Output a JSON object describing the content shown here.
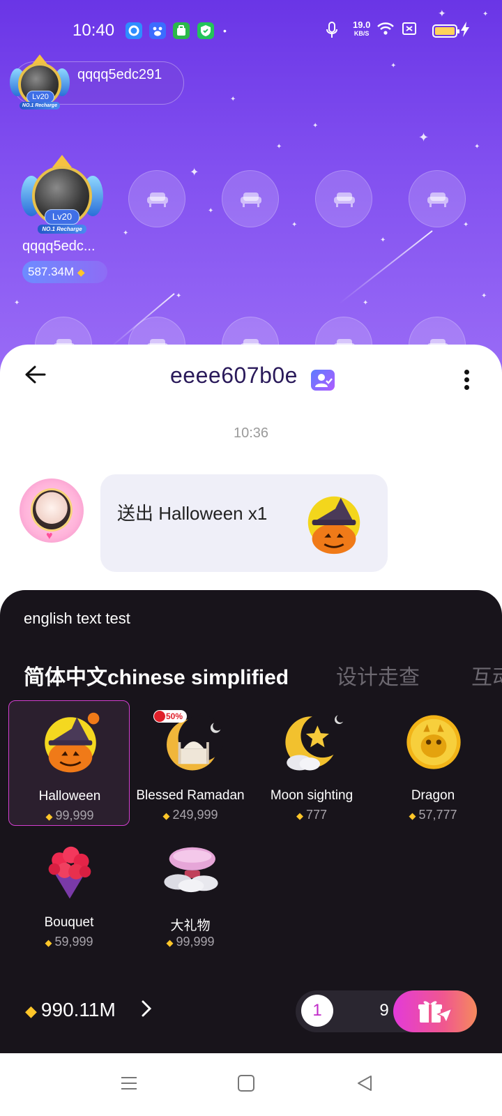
{
  "status_bar": {
    "time": "10:40",
    "net_speed_value": "19.0",
    "net_speed_unit": "KB/S"
  },
  "room": {
    "owner": {
      "name": "qqqq5edc291",
      "level": "Lv20",
      "badge": "NO.1 Recharge"
    },
    "host": {
      "name": "qqqq5edc...",
      "level": "Lv20",
      "badge": "NO.1 Recharge",
      "diamonds": "587.34M"
    }
  },
  "chat": {
    "title": "eeee607b0e",
    "timestamp": "10:36",
    "message": {
      "text": "送出 Halloween x1"
    }
  },
  "gift_panel": {
    "subtitle": "english text test",
    "tabs": [
      {
        "label": "简体中文chinese simplified",
        "active": true
      },
      {
        "label": "设计走查",
        "active": false
      },
      {
        "label": "互动",
        "active": false
      }
    ],
    "gifts": [
      {
        "name": "Halloween",
        "price": "99,999",
        "selected": true
      },
      {
        "name": "Blessed Ramadan",
        "price": "249,999",
        "discount": "50%"
      },
      {
        "name": "Moon sighting",
        "price": "777"
      },
      {
        "name": "Dragon",
        "price": "57,777"
      },
      {
        "name": "Bouquet",
        "price": "59,999"
      },
      {
        "name": "大礼物",
        "price": "99,999"
      }
    ],
    "balance": "990.11M",
    "quantity_options": [
      "1",
      "9"
    ],
    "selected_quantity": "1"
  },
  "colors": {
    "room_bg": "#7a45ec",
    "panel_bg": "#18141b",
    "accent": "#d33fd0",
    "diamond": "#ffc629"
  }
}
